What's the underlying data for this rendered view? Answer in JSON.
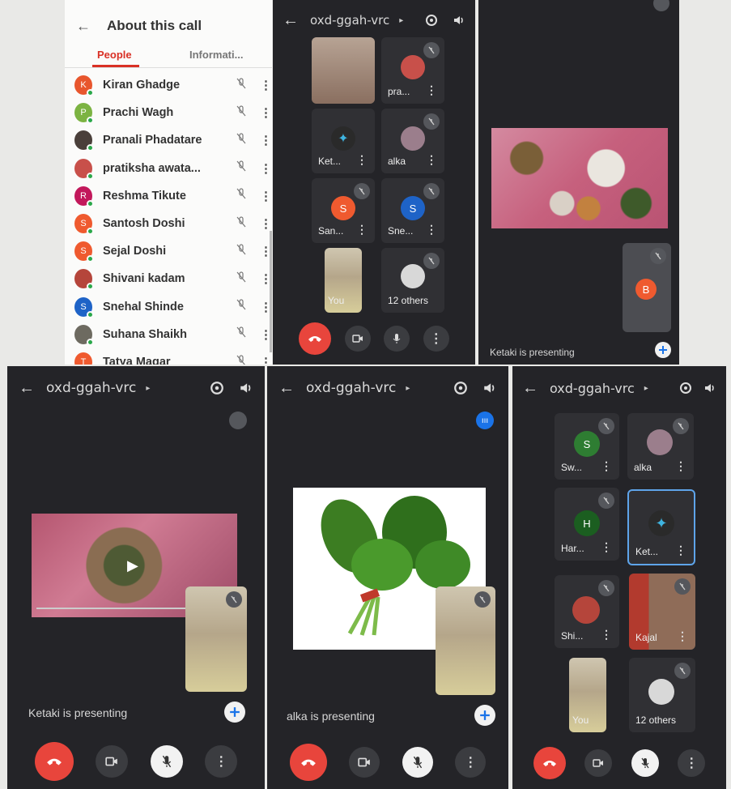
{
  "people_panel": {
    "title": "About this call",
    "tabs": [
      {
        "label": "People"
      },
      {
        "label": "Informati..."
      }
    ],
    "people": [
      {
        "name": "Kiran Ghadge",
        "initial": "K",
        "color": "#e8562d"
      },
      {
        "name": "Prachi Wagh",
        "initial": "P",
        "color": "#7cb342"
      },
      {
        "name": "Pranali Phadatare",
        "initial": "",
        "color": "#4a3f3a"
      },
      {
        "name": "pratiksha awata...",
        "initial": "",
        "color": "#c8504a"
      },
      {
        "name": "Reshma Tikute",
        "initial": "R",
        "color": "#c2185b"
      },
      {
        "name": "Santosh Doshi",
        "initial": "S",
        "color": "#ef5a2f"
      },
      {
        "name": "Sejal Doshi",
        "initial": "S",
        "color": "#ef5a2f"
      },
      {
        "name": "Shivani kadam",
        "initial": "",
        "color": "#b5453b"
      },
      {
        "name": "Snehal Shinde",
        "initial": "S",
        "color": "#1e63c7"
      },
      {
        "name": "Suhana Shaikh",
        "initial": "",
        "color": "#6d6a60"
      },
      {
        "name": "Tatya Magar",
        "initial": "T",
        "color": "#ef5a2f"
      }
    ]
  },
  "meeting_code": "oxd-ggah-vrc",
  "grid_top": {
    "tiles": [
      {
        "name": ""
      },
      {
        "name": "pra..."
      },
      {
        "name": "Ket..."
      },
      {
        "name": "alka"
      },
      {
        "name": "San...",
        "initial": "S"
      },
      {
        "name": "Sne...",
        "initial": "S"
      },
      {
        "name": "You"
      },
      {
        "name": "12 others"
      }
    ]
  },
  "presenting_top": {
    "text": "Ketaki is presenting",
    "self_initial": "B"
  },
  "presenting_left": {
    "text": "Ketaki is presenting"
  },
  "presenting_mid": {
    "text": "alka is presenting"
  },
  "grid_bottom": {
    "tiles": [
      {
        "name": "Sw...",
        "initial": "S"
      },
      {
        "name": "alka"
      },
      {
        "name": "Har...",
        "initial": "H"
      },
      {
        "name": "Ket..."
      },
      {
        "name": "Shi..."
      },
      {
        "name": "Kajal"
      },
      {
        "name": "You"
      },
      {
        "name": "12 others"
      }
    ]
  },
  "colors": {
    "end_call": "#e8453c",
    "accent_red": "#d93025",
    "active_border": "#5ea4ea"
  }
}
